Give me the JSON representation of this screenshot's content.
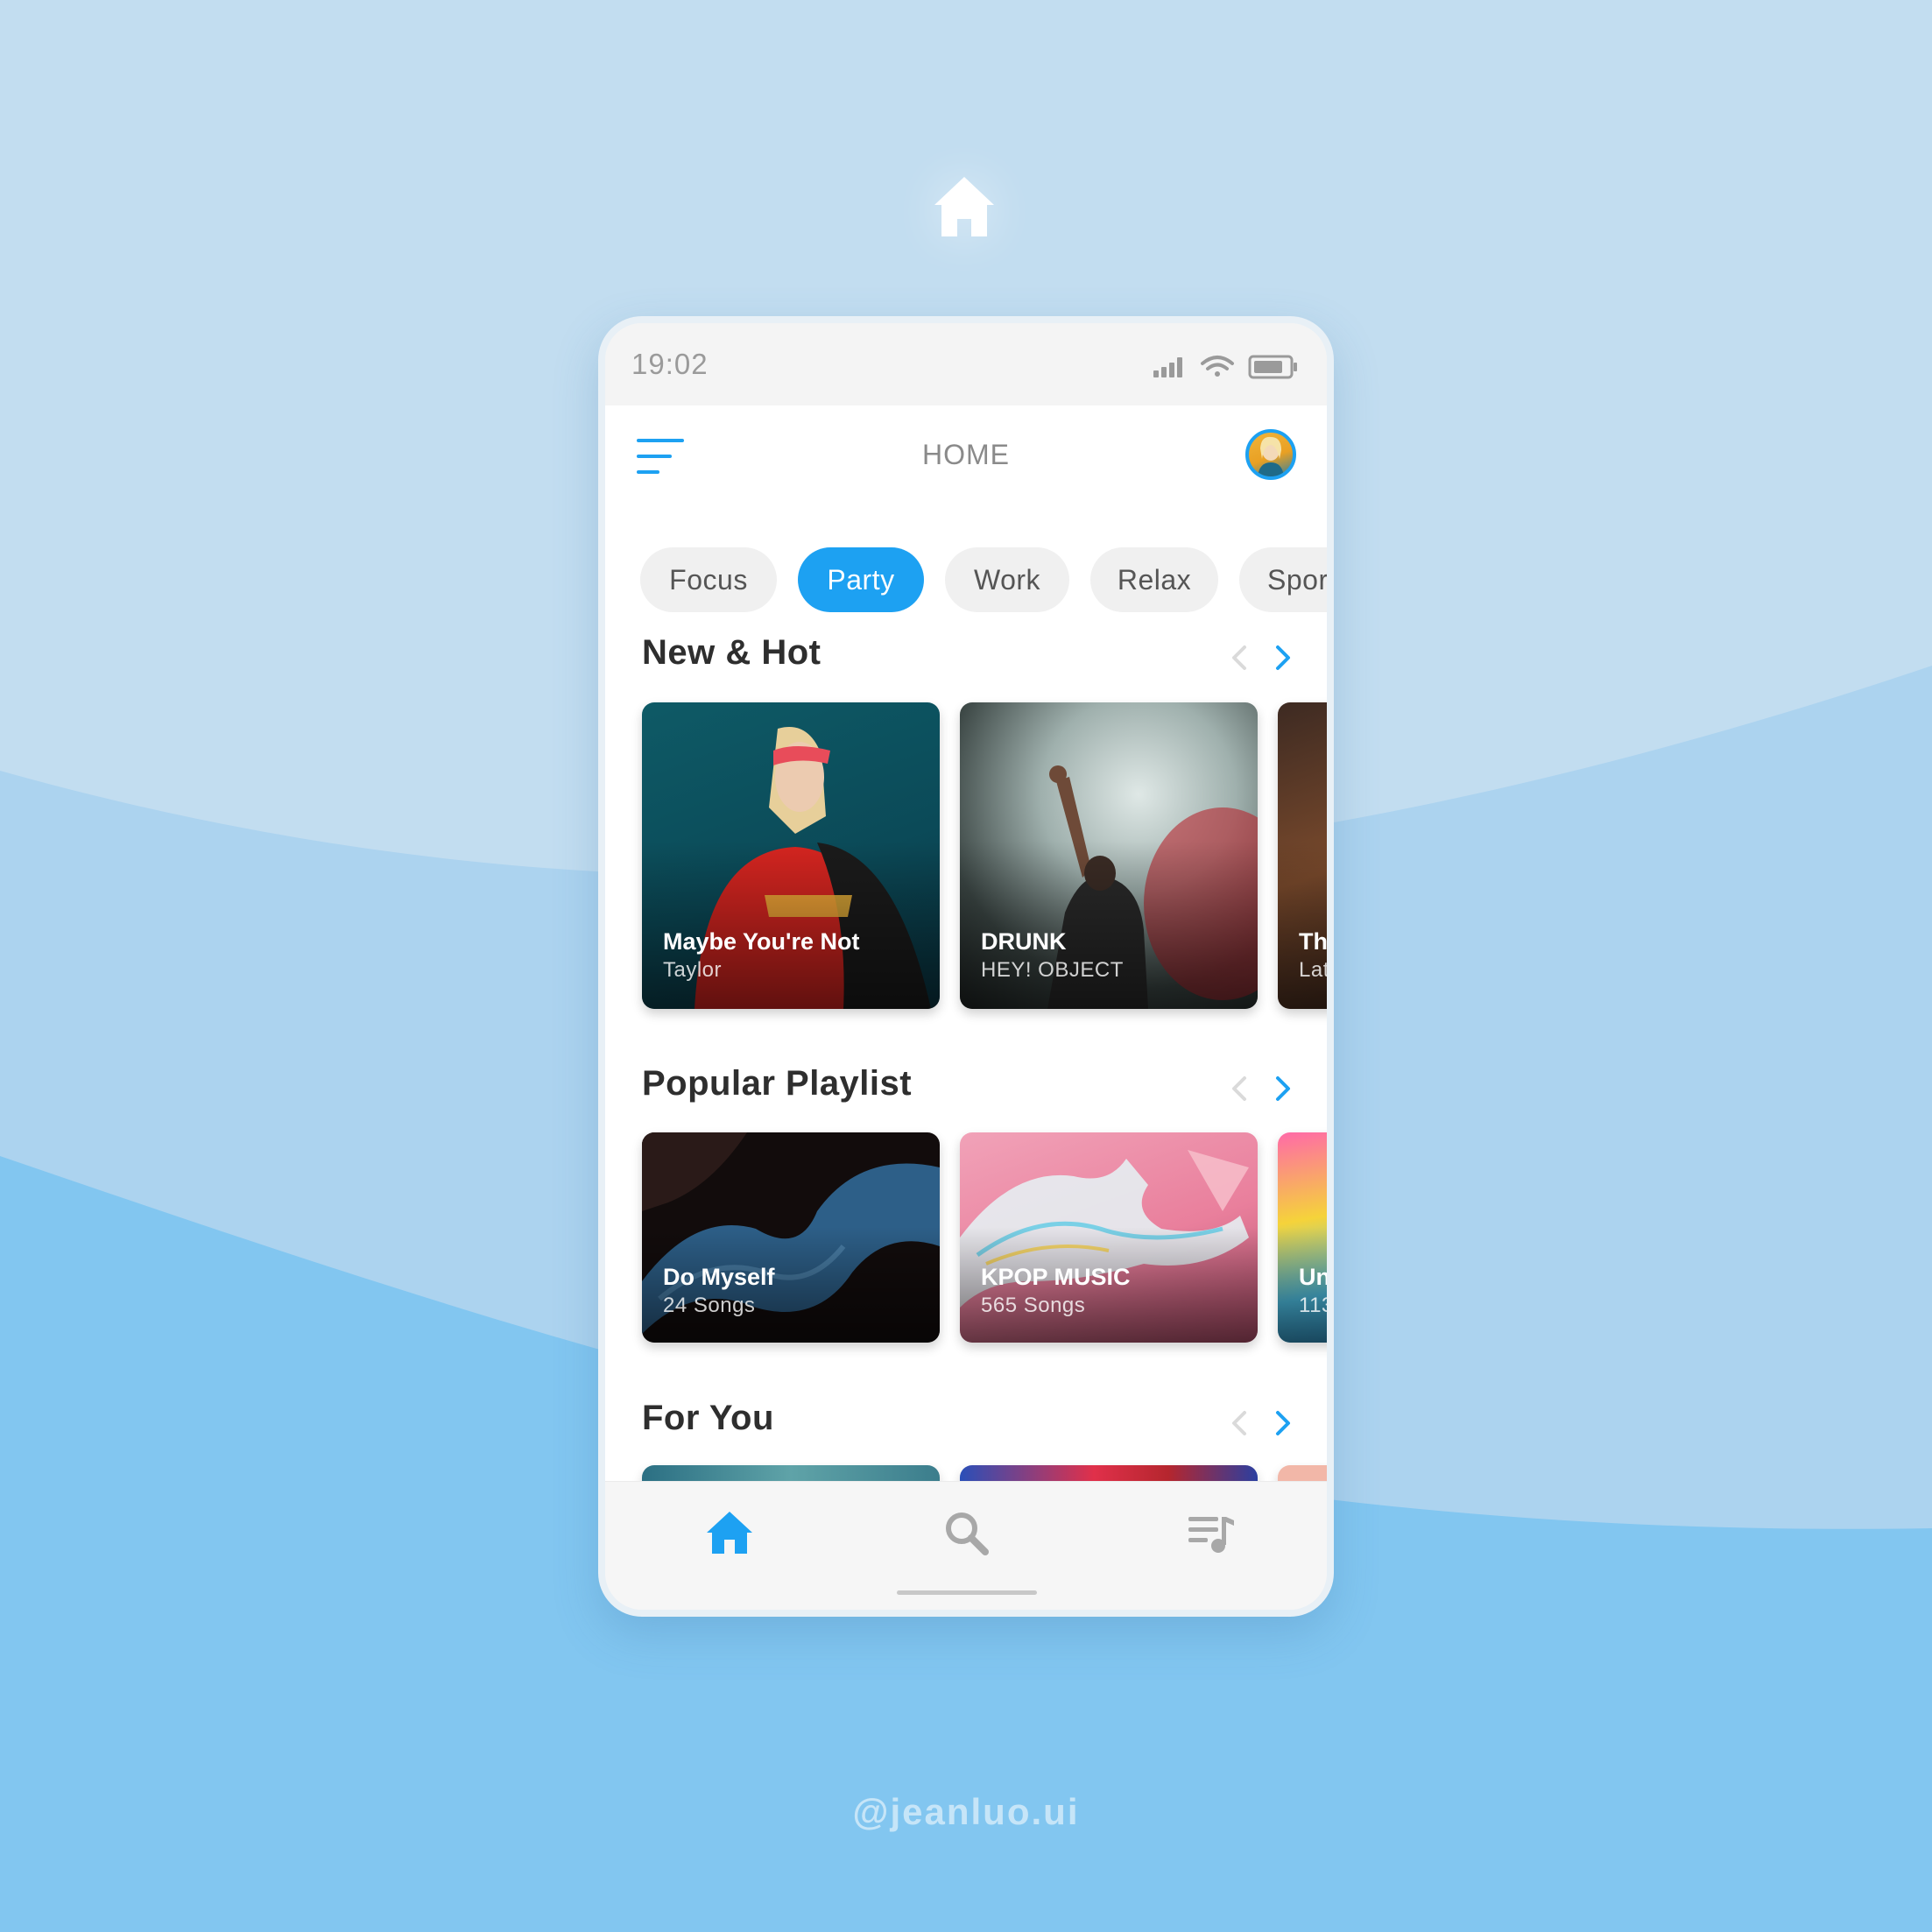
{
  "status_bar": {
    "time": "19:02"
  },
  "header": {
    "title": "HOME"
  },
  "chips": [
    {
      "label": "Focus",
      "active": false
    },
    {
      "label": "Party",
      "active": true
    },
    {
      "label": "Work",
      "active": false
    },
    {
      "label": "Relax",
      "active": false
    },
    {
      "label": "Spor",
      "active": false
    }
  ],
  "sections": {
    "new_hot": {
      "title": "New & Hot",
      "cards": [
        {
          "title": "Maybe You're Not",
          "subtitle": "Taylor"
        },
        {
          "title": "DRUNK",
          "subtitle": "HEY! OBJECT"
        },
        {
          "title": "Th",
          "subtitle": "Lat"
        }
      ]
    },
    "popular": {
      "title": "Popular Playlist",
      "cards": [
        {
          "title": "Do Myself",
          "subtitle": "24 Songs"
        },
        {
          "title": "KPOP MUSIC",
          "subtitle": "565 Songs"
        },
        {
          "title": "Un",
          "subtitle": "113"
        }
      ]
    },
    "for_you": {
      "title": "For You"
    }
  },
  "tab_bar": {
    "items": [
      {
        "icon": "home-icon",
        "active": true
      },
      {
        "icon": "search-icon",
        "active": false
      },
      {
        "icon": "playlist-icon",
        "active": false
      }
    ]
  },
  "colors": {
    "accent": "#1da1f2",
    "background_light": "#c2ddf0",
    "background_mid": "#acd3ef",
    "background_deep": "#82c6f0"
  },
  "watermark": "@jeanluo.ui"
}
